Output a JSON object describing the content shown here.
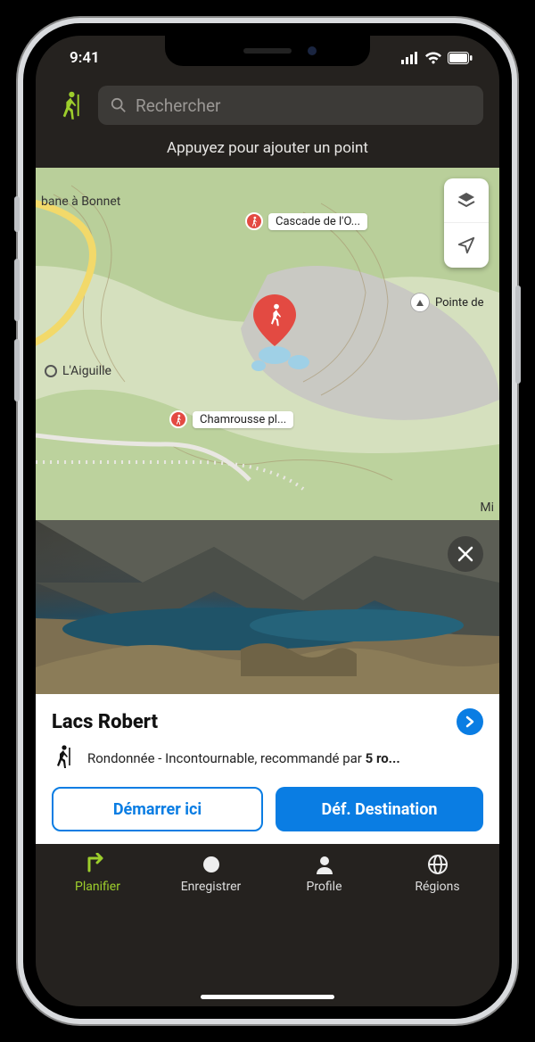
{
  "status": {
    "time": "9:41"
  },
  "header": {
    "search_placeholder": "Rechercher"
  },
  "hint": "Appuyez pour ajouter un point",
  "map": {
    "pois": [
      {
        "label": "Cascade de l'O..."
      },
      {
        "label": "Chamrousse pl..."
      }
    ],
    "peak_label": "Pointe de",
    "side_labels": {
      "left_top": "bane à Bonnet",
      "left_mid": "L'Aiguille",
      "right_bottom": "Mi"
    }
  },
  "info": {
    "title": "Lacs Robert",
    "subtitle_prefix": "Rondonnée - Incontournable, recommandé par ",
    "subtitle_bold": "5 ro...",
    "btn_start": "Démarrer ici",
    "btn_dest": "Déf. Destination"
  },
  "tabs": {
    "plan": "Planifier",
    "record": "Enregistrer",
    "profile": "Profile",
    "regions": "Régions"
  }
}
